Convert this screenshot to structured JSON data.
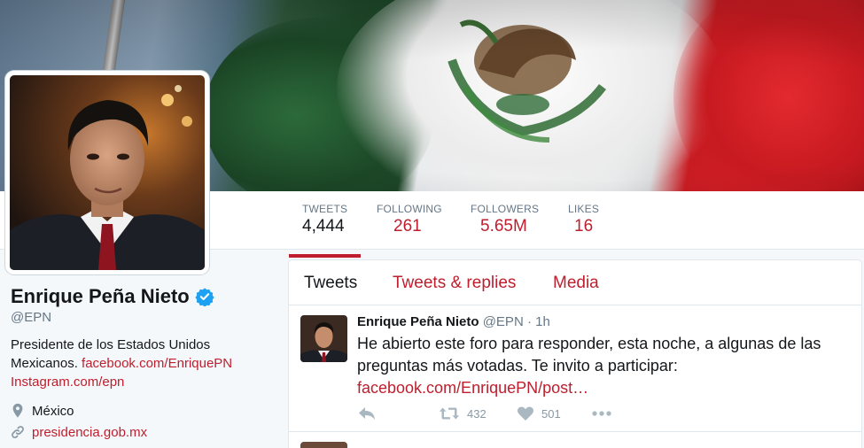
{
  "profile": {
    "name": "Enrique Peña Nieto",
    "handle": "@EPN",
    "bio_text": "Presidente de los Estados Unidos Mexicanos.",
    "bio_link1": "facebook.com/EnriquePN",
    "bio_link2": "Instagram.com/epn",
    "location": "México",
    "website": "presidencia.gob.mx"
  },
  "stats": [
    {
      "label": "TWEETS",
      "value": "4,444"
    },
    {
      "label": "FOLLOWING",
      "value": "261"
    },
    {
      "label": "FOLLOWERS",
      "value": "5.65M"
    },
    {
      "label": "LIKES",
      "value": "16"
    }
  ],
  "timeline": {
    "tabs": [
      "Tweets",
      "Tweets & replies",
      "Media"
    ],
    "tweet": {
      "name": "Enrique Peña Nieto",
      "handle": "@EPN",
      "dot": "·",
      "time": "1h",
      "text": "He abierto este foro para responder, esta noche, a algunas de las preguntas más votadas. Te invito a participar:",
      "link": "facebook.com/EnriquePN/post…",
      "retweets": "432",
      "likes": "501"
    }
  },
  "colors": {
    "accent": "#be1e2d",
    "verified": "#1da1f2",
    "muted": "#657786"
  },
  "icons": [
    "verified-icon",
    "location-pin-icon",
    "link-icon",
    "reply-icon",
    "retweet-icon",
    "heart-icon",
    "more-icon"
  ]
}
